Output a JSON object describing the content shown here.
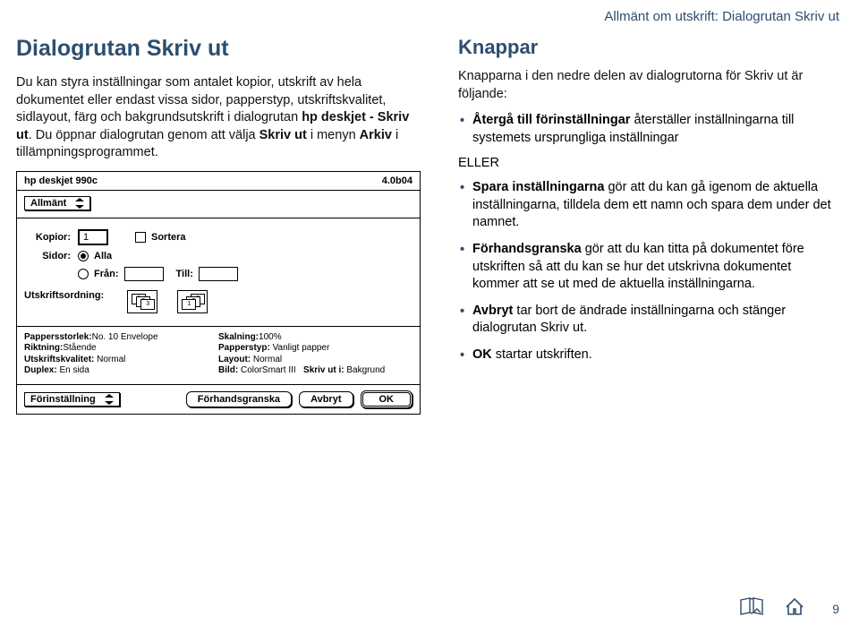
{
  "header_right": "Allmänt om utskrift: Dialogrutan Skriv ut",
  "page_number": "9",
  "left": {
    "title": "Dialogrutan Skriv ut",
    "para1_a": "Du kan styra inställningar som antalet kopior, utskrift av hela dokumentet eller endast vissa sidor, papperstyp, utskriftskvalitet, sidlayout, färg och bakgrundsutskrift i dialogrutan ",
    "para1_b": "hp deskjet - Skriv ut",
    "para1_c": ". Du öppnar dialogrutan genom att välja ",
    "para1_d": "Skriv ut",
    "para1_e": " i menyn ",
    "para1_f": "Arkiv",
    "para1_g": " i tillämpningsprogrammet."
  },
  "right": {
    "title": "Knappar",
    "intro": "Knapparna i den nedre delen av dialogrutorna för Skriv ut är följande:",
    "bullets1": [
      {
        "b": "Återgå till förinställningar",
        "rest": " återställer inställningarna till systemets ursprungliga inställningar"
      }
    ],
    "eller": "ELLER",
    "bullets2": [
      {
        "b": "Spara inställningarna",
        "rest": " gör att du kan gå igenom de aktuella inställningarna, tilldela dem ett namn och spara dem under det namnet."
      },
      {
        "b": "Förhandsgranska",
        "rest": " gör att du kan titta på dokumentet före utskriften så att du kan se hur det utskrivna dokumentet kommer att se ut med de aktuella inställningarna."
      },
      {
        "b": "Avbryt",
        "rest": " tar bort de ändrade inställningarna och stänger dialogrutan Skriv ut."
      },
      {
        "b": "OK",
        "rest": " startar utskriften."
      }
    ]
  },
  "dialog": {
    "title": "hp deskjet 990c",
    "version": "4.0b04",
    "tab_selector": "Allmänt",
    "kopior_label": "Kopior:",
    "kopior_value": "1",
    "sortera_label": "Sortera",
    "sidor_label": "Sidor:",
    "alla_label": "Alla",
    "fran_label": "Från:",
    "till_label": "Till:",
    "ordning_label": "Utskriftsordning:",
    "info": {
      "paperstorlek_k": "Pappersstorlek:",
      "pappersstorlek_v": "No. 10 Envelope",
      "skalning_k": "Skalning:",
      "skalning_v": "100%",
      "riktning_k": "Riktning:",
      "riktning_v": "Stående",
      "papperstyp_k": "Papperstyp:",
      "papperstyp_v": "Vanligt papper",
      "kvalitet_k": "Utskriftskvalitet:",
      "kvalitet_v": "Normal",
      "layout_k": "Layout:",
      "layout_v": "Normal",
      "duplex_k": "Duplex:",
      "duplex_v": "En sida",
      "bild_k": "Bild:",
      "bild_v": "ColorSmart III",
      "skrivuti_k": "Skriv ut i:",
      "skrivuti_v": "Bakgrund"
    },
    "footer": {
      "forinstallning": "Förinställning",
      "forhandsgranska": "Förhandsgranska",
      "avbryt": "Avbryt",
      "ok": "OK"
    }
  }
}
